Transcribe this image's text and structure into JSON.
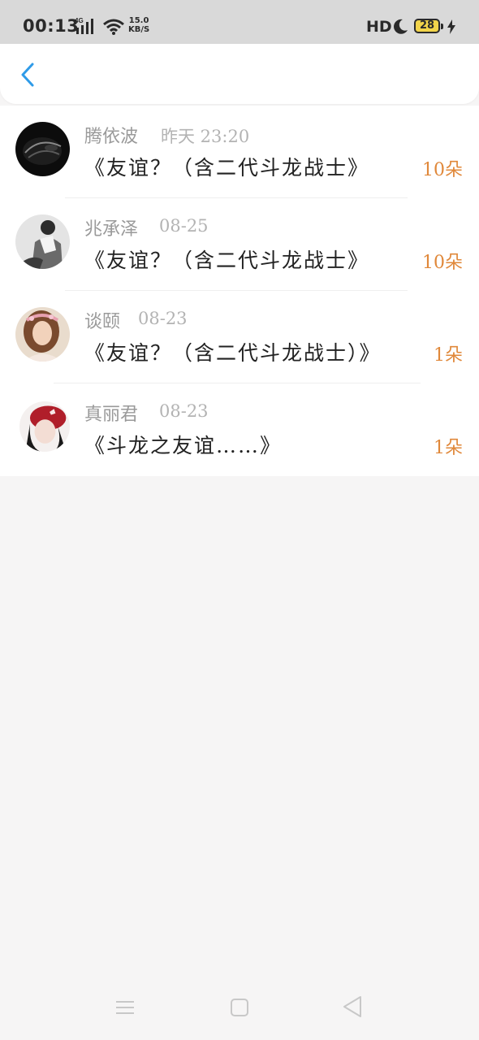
{
  "status_bar": {
    "time": "00:13",
    "network_type": "4G",
    "speed_value": "15.0",
    "speed_unit": "KB/S",
    "hd_label": "HD",
    "battery_level": "28"
  },
  "header": {
    "back_icon": "chevron-left-icon"
  },
  "colors": {
    "accent": "#2f9be8",
    "count": "#e0883a",
    "name": "#9a9a9a",
    "time": "#b3b3b3",
    "title": "#222222"
  },
  "items": [
    {
      "name": "腾依波",
      "time": "昨天 23:20",
      "title": "《友谊？（含二代斗龙战士》",
      "count": "10朵",
      "avatar": "black-motorcycle-helmet-avatar"
    },
    {
      "name": "兆承泽",
      "time": "08-25",
      "title": "《友谊？（含二代斗龙战士》",
      "count": "10朵",
      "avatar": "monochrome-person-avatar"
    },
    {
      "name": "谈颐",
      "time": "08-23",
      "title": "《友谊？（含二代斗龙战士）》",
      "count": "1朵",
      "avatar": "girl-with-flower-crown-avatar"
    },
    {
      "name": "真丽君",
      "time": "08-23",
      "title": "《斗龙之友谊……》",
      "count": "1朵",
      "avatar": "girl-with-red-hat-avatar"
    }
  ],
  "nav_bar": {
    "menu_icon": "menu-icon",
    "home_icon": "square-home-icon",
    "back_icon": "triangle-back-icon"
  }
}
